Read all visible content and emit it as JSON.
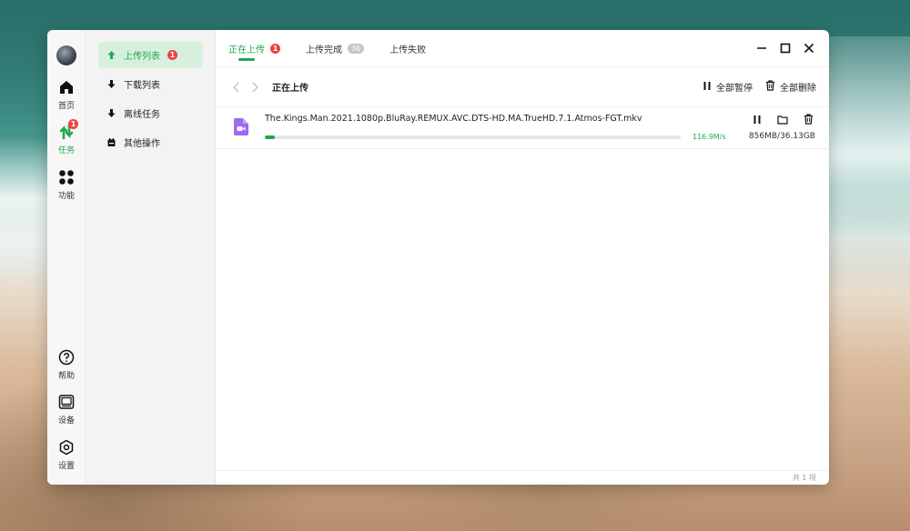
{
  "rail": {
    "items": [
      {
        "label": "首页",
        "icon": "home-icon"
      },
      {
        "label": "任务",
        "icon": "transfer-icon",
        "badge": "1"
      },
      {
        "label": "功能",
        "icon": "grid-icon"
      },
      {
        "label": "帮助",
        "icon": "help-icon"
      },
      {
        "label": "设备",
        "icon": "device-icon"
      },
      {
        "label": "设置",
        "icon": "settings-icon"
      }
    ]
  },
  "sidebar": {
    "items": [
      {
        "label": "上传列表",
        "icon": "upload-icon",
        "badge": "1"
      },
      {
        "label": "下载列表",
        "icon": "download-icon"
      },
      {
        "label": "离线任务",
        "icon": "offline-icon"
      },
      {
        "label": "其他操作",
        "icon": "other-icon"
      }
    ]
  },
  "tabs": [
    {
      "label": "正在上传",
      "badge": "1"
    },
    {
      "label": "上传完成",
      "badge": "36"
    },
    {
      "label": "上传失败"
    }
  ],
  "toolbar": {
    "title": "正在上传",
    "pause_all": "全部暂停",
    "delete_all": "全部删除"
  },
  "uploads": [
    {
      "file_name": "The.Kings.Man.2021.1080p.BluRay.REMUX.AVC.DTS-HD.MA.TrueHD.7.1.Atmos-FGT.mkv",
      "progress_pct": 2.3,
      "speed": "116.9M/s",
      "size": "856MB/36.13GB"
    }
  ],
  "footer": {
    "page_count": "共 1 项"
  },
  "colors": {
    "accent": "#1fa84f",
    "badge": "#f0413f",
    "file_icon": "#9b6cf0"
  }
}
